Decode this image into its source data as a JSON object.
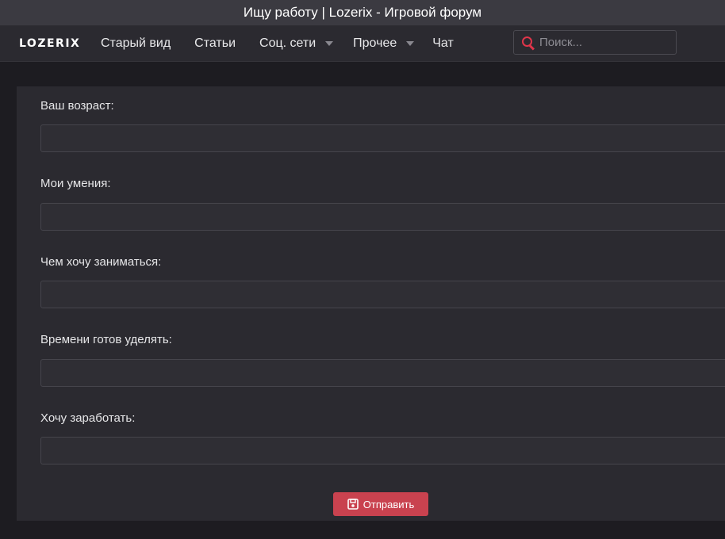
{
  "window": {
    "title": "Ищу работу | Lozerix - Игровой форум"
  },
  "nav": {
    "logo": "LOZERIX",
    "items": [
      {
        "label": "Старый вид",
        "dropdown": false
      },
      {
        "label": "Статьи",
        "dropdown": false
      },
      {
        "label": "Соц. сети",
        "dropdown": true,
        "icon": "caret-down-icon"
      },
      {
        "label": "Прочее",
        "dropdown": true,
        "icon": "caret-down-icon"
      },
      {
        "label": "Чат",
        "dropdown": false
      }
    ],
    "search": {
      "placeholder": "Поиск...",
      "value": "",
      "icon": "search-icon"
    }
  },
  "form": {
    "fields": [
      {
        "label": "Ваш возраст:",
        "value": ""
      },
      {
        "label": "Мои умения:",
        "value": ""
      },
      {
        "label": "Чем хочу заниматься:",
        "value": ""
      },
      {
        "label": "Времени готов уделять:",
        "value": ""
      },
      {
        "label": "Хочу заработать:",
        "value": ""
      }
    ],
    "submit": {
      "label": "Отправить",
      "icon": "save-icon"
    }
  },
  "colors": {
    "accent": "#c9424f",
    "search_icon": "#e0354a",
    "background": "#1d1c21",
    "panel": "#2b2a30",
    "titlebar": "#3b3a41"
  }
}
